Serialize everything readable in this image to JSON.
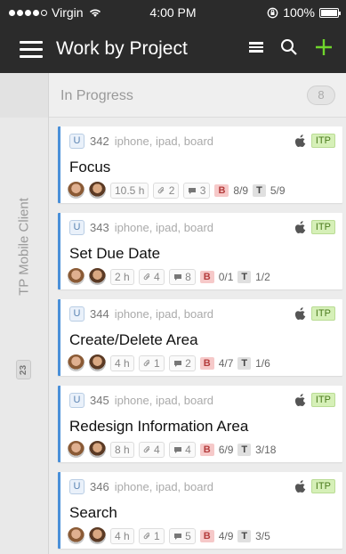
{
  "status": {
    "carrier": "Virgin",
    "time": "4:00 PM",
    "battery": "100%"
  },
  "nav": {
    "title": "Work by Project"
  },
  "column": {
    "title": "In Progress",
    "count": "8"
  },
  "row": {
    "label": "TP Mobile Client",
    "count": "23"
  },
  "colors": {
    "accent_green": "#6fd52c",
    "card_border_blue": "#4a90d9",
    "bug_red": "#b43d3d"
  },
  "cards": [
    {
      "type": "U",
      "id": "342",
      "tags": "iphone, ipad, board",
      "platform": "apple-icon",
      "state": "ITP",
      "title": "Focus",
      "time": "10.5 h",
      "attachments": "2",
      "comments": "3",
      "bugs_label": "B",
      "bugs": "8/9",
      "tasks_label": "T",
      "tasks": "5/9"
    },
    {
      "type": "U",
      "id": "343",
      "tags": "iphone, ipad, board",
      "platform": "apple-icon",
      "state": "ITP",
      "title": "Set Due Date",
      "time": "2 h",
      "attachments": "4",
      "comments": "8",
      "bugs_label": "B",
      "bugs": "0/1",
      "tasks_label": "T",
      "tasks": "1/2"
    },
    {
      "type": "U",
      "id": "344",
      "tags": "iphone, ipad, board",
      "platform": "apple-icon",
      "state": "ITP",
      "title": "Create/Delete Area",
      "time": "4 h",
      "attachments": "1",
      "comments": "2",
      "bugs_label": "B",
      "bugs": "4/7",
      "tasks_label": "T",
      "tasks": "1/6"
    },
    {
      "type": "U",
      "id": "345",
      "tags": "iphone, ipad, board",
      "platform": "apple-icon",
      "state": "ITP",
      "title": "Redesign Information Area",
      "time": "8 h",
      "attachments": "4",
      "comments": "4",
      "bugs_label": "B",
      "bugs": "6/9",
      "tasks_label": "T",
      "tasks": "3/18"
    },
    {
      "type": "U",
      "id": "346",
      "tags": "iphone, ipad, board",
      "platform": "apple-icon",
      "state": "ITP",
      "title": "Search",
      "time": "4 h",
      "attachments": "1",
      "comments": "5",
      "bugs_label": "B",
      "bugs": "4/9",
      "tasks_label": "T",
      "tasks": "3/5"
    }
  ]
}
